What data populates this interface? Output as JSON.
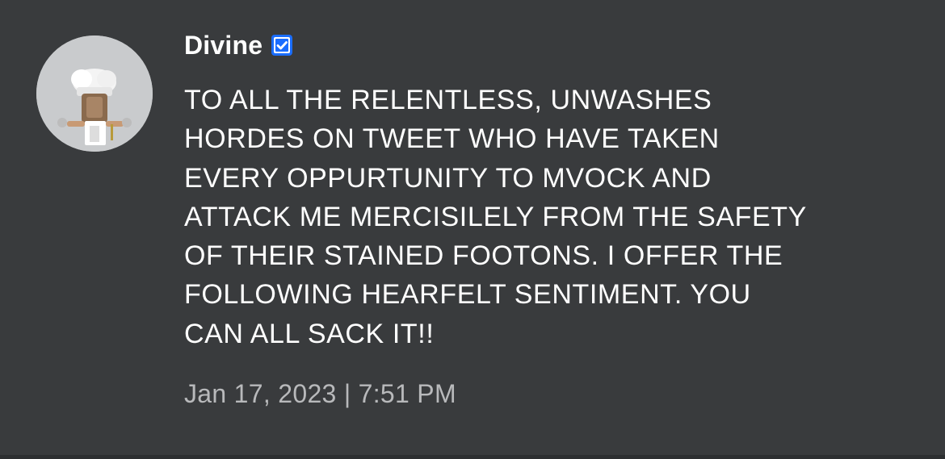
{
  "post": {
    "author": {
      "name": "Divine",
      "verified_icon": "verified-badge-icon",
      "avatar_icon": "avatar-character-icon"
    },
    "body_lines": [
      "TO ALL THE RELENTLESS, UNWASHES",
      "HORDES ON TWEET WHO HAVE TAKEN",
      "EVERY OPPURTUNITY TO MVOCK AND",
      "ATTACK ME MERCISILELY FROM THE SAFETY",
      "OF THEIR STAINED FOOTONS. I OFFER THE",
      "FOLLOWING HEARFELT SENTIMENT. YOU",
      "CAN ALL SACK IT!!"
    ],
    "timestamp": "Jan 17, 2023 | 7:51 PM"
  },
  "colors": {
    "background": "#393b3d",
    "text": "#ffffff",
    "timestamp_text": "#b8b9bb",
    "verified_blue": "#1a6dff",
    "avatar_bg": "#c9cbcd"
  }
}
